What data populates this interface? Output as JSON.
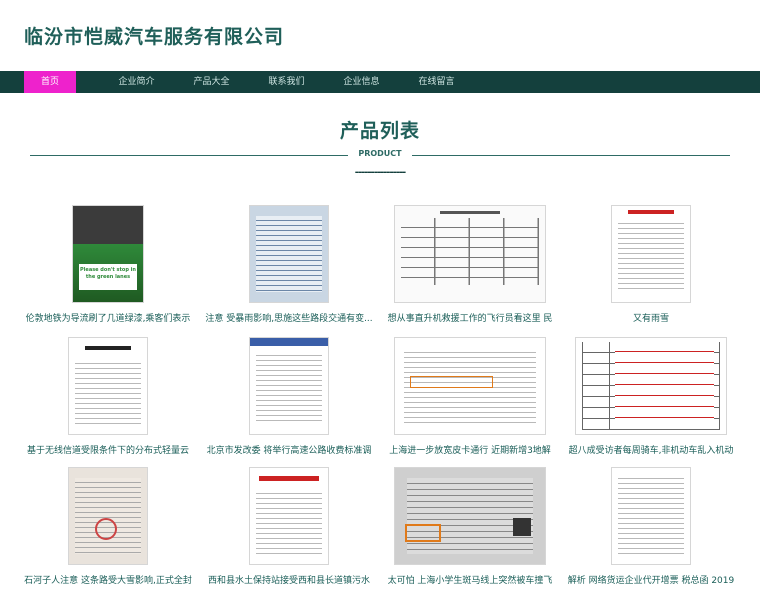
{
  "site": {
    "title": "临汾市恺威汽车服务有限公司"
  },
  "nav": {
    "items": [
      "首页",
      "企业简介",
      "产品大全",
      "联系我们",
      "企业信息",
      "在线留言"
    ]
  },
  "section": {
    "title": "产品列表",
    "subtitle": "PRODUCT",
    "dashes": "----------------"
  },
  "products": [
    {
      "caption": "伦敦地铁为导流刷了几道绿漆,乘客们表示",
      "thumb_text": "Please don't stop in the green lanes",
      "accent": "#2f8a3a"
    },
    {
      "caption": "注意 受暴雨影响,思施这些路段交通有变...",
      "thumb_text": "",
      "accent": "#6c87a8"
    },
    {
      "caption": "想从事直升机救援工作的飞行员看这里 民",
      "thumb_text": "",
      "accent": "#444444"
    },
    {
      "caption": "又有雨雪",
      "thumb_text": "",
      "accent": "#cc2222"
    },
    {
      "caption": "基于无线信道受限条件下的分布式轻量云",
      "thumb_text": "",
      "accent": "#222222"
    },
    {
      "caption": "北京市发改委 将举行高速公路收费标准调",
      "thumb_text": "",
      "accent": "#3a5ea8"
    },
    {
      "caption": "上海进一步放宽皮卡通行 近期新增3地解",
      "thumb_text": "",
      "accent": "#e07a1a"
    },
    {
      "caption": "超八成受访者每周骑车,非机动车乱入机动",
      "thumb_text": "",
      "accent": "#cc2222"
    },
    {
      "caption": "石河子人注意 这条路受大雪影响,正式全封",
      "thumb_text": "",
      "accent": "#cc4444"
    },
    {
      "caption": "西和县水土保持站接受西和县长道镇污水",
      "thumb_text": "",
      "accent": "#cc2222"
    },
    {
      "caption": "太可怕 上海小学生斑马线上突然被车撞飞",
      "thumb_text": "",
      "accent": "#e07a1a"
    },
    {
      "caption": "解析 网络货运企业代开增票 税总函 2019",
      "thumb_text": "",
      "accent": "#555555"
    }
  ]
}
